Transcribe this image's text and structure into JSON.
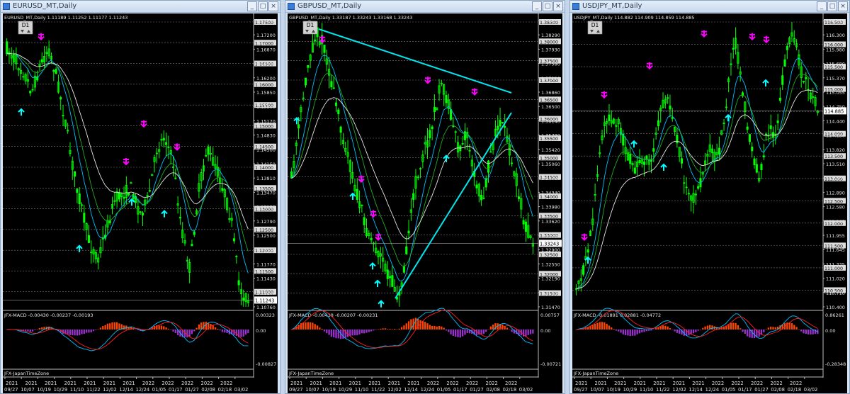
{
  "windows": [
    {
      "id": "eurusd",
      "title": "EURUSD_MT,Daily",
      "ohlc_line": "EURUSD_MT,Daily 1.11189 1.11252 1.11177 1.11243",
      "timeframe_badge": "D1",
      "price_scale": [
        "1.17590",
        "1.17200",
        "1.16870",
        "1.16500",
        "1.16200",
        "1.15850",
        "1.15500",
        "1.15170",
        "1.14830",
        "1.14500",
        "1.14150",
        "1.13810",
        "1.13470",
        "1.13130",
        "1.12790",
        "1.12500",
        "1.12110",
        "1.11770",
        "1.11430",
        "1.11100",
        "1.10760"
      ],
      "price_labels_boxed": [
        "1.17500",
        "1.17000",
        "1.16500",
        "1.16000",
        "1.15500",
        "1.15000",
        "1.14500",
        "1.14000",
        "1.13500",
        "1.13000",
        "1.12500",
        "1.12000",
        "1.11500",
        "1.11000"
      ],
      "current_price": "1.11243",
      "macd_label": "JFX-MACD -0.00430 -0.00237 -0.00193",
      "macd_scale": [
        "0.00323",
        "0.00",
        "-0.00827"
      ],
      "tz_label": "JFX-JapanTimeZone",
      "years": [
        "2021",
        "2021",
        "2021",
        "2021",
        "2021",
        "2021",
        "2021",
        "2022",
        "2022",
        "2022",
        "2022",
        "2022"
      ],
      "dates": [
        "09/27",
        "10/07",
        "10/19",
        "10/29",
        "11/10",
        "11/22",
        "12/02",
        "12/14",
        "12/24",
        "01/05",
        "01/17",
        "01/27",
        "02/08",
        "02/18",
        "03/02"
      ]
    },
    {
      "id": "gbpusd",
      "title": "GBPUSD_MT,Daily",
      "ohlc_line": "GBPUSD_MT,Daily 1.33187 1.33243 1.33168 1.33243",
      "timeframe_badge": "D1",
      "price_scale": [
        "1.38650",
        "1.38290",
        "1.37930",
        "1.37580",
        "1.37220",
        "1.36860",
        "1.36500",
        "1.36140",
        "1.35780",
        "1.35420",
        "1.35060",
        "1.34700",
        "1.34340",
        "1.33980",
        "1.33620",
        "1.33260",
        "1.32900",
        "1.32550",
        "1.32190",
        "1.31830",
        "1.31470"
      ],
      "price_labels_boxed": [
        "1.38500",
        "1.38000",
        "1.37500",
        "1.37000",
        "1.36500",
        "1.36000",
        "1.35500",
        "1.35000",
        "1.34500",
        "1.34000",
        "1.33500",
        "1.33000",
        "1.32500",
        "1.32000",
        "1.31500"
      ],
      "current_price": "1.33243",
      "macd_label": "JFX-MACD -0.00438 -0.00207 -0.00231",
      "macd_scale": [
        "0.00757",
        "0.00",
        "-0.00721"
      ],
      "tz_label": "JFX-JapanTimeZone",
      "years": [
        "2021",
        "2021",
        "2021",
        "2021",
        "2021",
        "2021",
        "2021",
        "2022",
        "2022",
        "2022",
        "2022",
        "2022"
      ],
      "dates": [
        "09/27",
        "10/07",
        "10/19",
        "10/29",
        "11/10",
        "11/22",
        "12/02",
        "12/14",
        "12/24",
        "01/05",
        "01/17",
        "01/27",
        "02/08",
        "02/18",
        "03/02"
      ]
    },
    {
      "id": "usdjpy",
      "title": "USDJPY_MT,Daily",
      "ohlc_line": "USDJPY_MT,Daily 114.882 114.909 114.859 114.885",
      "timeframe_badge": "D1",
      "price_scale": [
        "116.615",
        "116.300",
        "115.980",
        "115.680",
        "115.370",
        "115.055",
        "114.750",
        "114.440",
        "114.130",
        "113.820",
        "113.510",
        "113.200",
        "112.890",
        "112.580",
        "112.265",
        "111.955",
        "111.645",
        "111.335",
        "111.020",
        "110.710",
        "110.400"
      ],
      "price_labels_boxed": [
        "116.500",
        "116.000",
        "115.500",
        "115.000",
        "114.500",
        "114.000",
        "113.500",
        "113.000",
        "112.500",
        "112.000",
        "111.500",
        "111.000",
        "110.500"
      ],
      "current_price": "114.885",
      "macd_label": "JFX-MACD -0.01891 0.02881 -0.04772",
      "macd_scale": [
        "0.86261",
        "0.00",
        "-0.28348"
      ],
      "tz_label": "JFX-JapanTimeZone",
      "years": [
        "2021",
        "2021",
        "2021",
        "2021",
        "2021",
        "2021",
        "2021",
        "2022",
        "2022",
        "2022",
        "2022",
        "2022"
      ],
      "dates": [
        "09/27",
        "10/07",
        "10/19",
        "10/29",
        "11/10",
        "11/22",
        "12/02",
        "12/14",
        "12/24",
        "01/05",
        "01/17",
        "01/27",
        "02/08",
        "02/18",
        "03/02"
      ]
    }
  ],
  "window_buttons": {
    "minimize": "_",
    "maximize": "□",
    "close": "×"
  },
  "colors": {
    "background": "#000000",
    "candles": "#00ff00",
    "ma_fast": "#00bfff",
    "ma_mid": "#22aa22",
    "ma_slow": "#e6e6e6",
    "trendline": "#00e5ee",
    "arrow_down": "#ff00ff",
    "arrow_up": "#00ffff",
    "macd_positive": "#ff4500",
    "macd_negative": "#9932cc",
    "macd_signal": "#ff2020",
    "macd_main": "#00bfff"
  },
  "icons": [
    "timeframe-down-icon",
    "timeframe-up-icon",
    "arrow-down-icon",
    "arrow-up-icon"
  ]
}
